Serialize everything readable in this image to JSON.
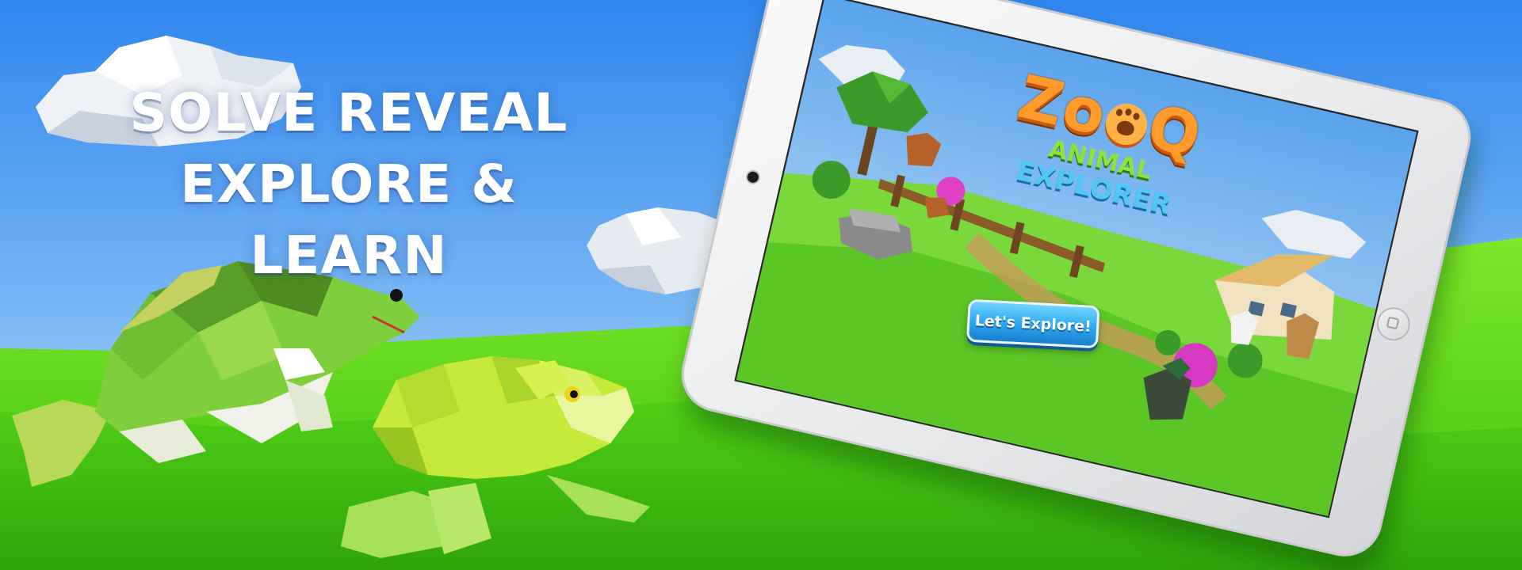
{
  "headline": {
    "line1": "SOLVE REVEAL",
    "line2": "EXPLORE & LEARN"
  },
  "app": {
    "logo_prefix": "Zo",
    "logo_suffix": "Q",
    "logo_line2": "ANIMAL",
    "logo_line3": "EXPLORER",
    "cta_label": "Let's Explore!"
  },
  "colors": {
    "sky_top": "#2f86ee",
    "sky_bottom": "#cfe7f8",
    "grass": "#46c915",
    "grass_light": "#7ee829",
    "button_blue": "#2aa6ee",
    "logo_orange": "#ff9b2a"
  }
}
